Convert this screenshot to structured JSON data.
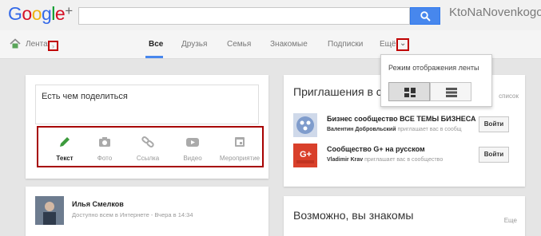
{
  "header": {
    "logo": {
      "g": "G",
      "o1": "o",
      "o2": "o",
      "g2": "g",
      "l": "l",
      "e": "e",
      "plus": "+"
    },
    "search_placeholder": "",
    "watermark": "KtoNaNovenkogo.ru"
  },
  "nav": {
    "home_label": "Лента",
    "tabs": [
      "Все",
      "Друзья",
      "Семья",
      "Знакомые",
      "Подписки",
      "Ещё"
    ]
  },
  "popup": {
    "title": "Режим отображения ленты"
  },
  "share": {
    "placeholder": "Есть чем поделиться",
    "actions": [
      "Текст",
      "Фото",
      "Ссылка",
      "Видео",
      "Мероприятие"
    ]
  },
  "invites": {
    "title": "Приглашения в с",
    "list_link": "список",
    "items": [
      {
        "name": "Бизнес сообщество ВСЕ ТЕМЫ БИЗНЕСА",
        "inviter": "Валентин Добровльский",
        "text": "приглашает вас в сообщ",
        "button": "Войти"
      },
      {
        "name": "Сообщество G+ на русском",
        "inviter": "Vladimir Krav",
        "text": "приглашает вас в сообщество",
        "button": "Войти"
      }
    ]
  },
  "post": {
    "author": "Илья Смелков",
    "meta": "Доступно всем в Интернете - Вчера в 14:34"
  },
  "suggest": {
    "title": "Возможно, вы знакомы",
    "more": "Еще"
  }
}
